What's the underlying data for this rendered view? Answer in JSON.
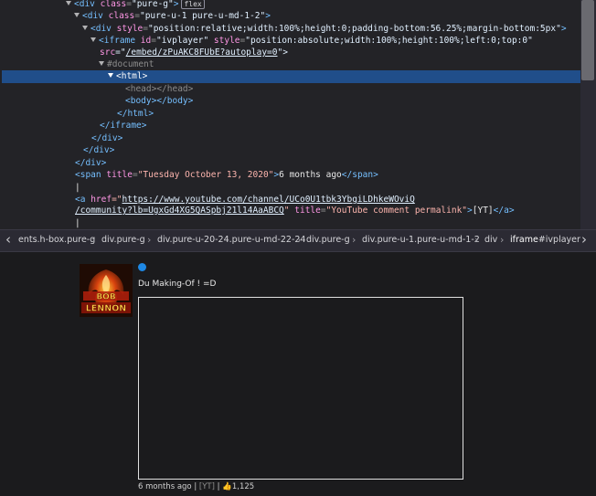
{
  "inspector": {
    "flex_badge": "flex",
    "lines": {
      "l0_open": "<div",
      "l0_attr": "class",
      "l0_val": "\"pure-g\"",
      "l0_close": ">",
      "l1_open": "<div",
      "l1_attr": "class",
      "l1_val": "\"pure-u-1 pure-u-md-1-2\"",
      "l1_close": ">",
      "l2_open": "<div",
      "l2_attr": "style",
      "l2_val": "\"position:relative;width:100%;height:0;padding-bottom:56.25%;margin-bottom:5px\"",
      "l2_close": ">",
      "l3_open": "<iframe",
      "l3_attr1": "id",
      "l3_val1": "\"ivplayer\"",
      "l3_attr2": "style",
      "l3_val2": "\"position:absolute;width:100%;height:100%;left:0;top:0\"",
      "l4_attr": "src",
      "l4_eq": "=\"",
      "l4_url": "/embed/zPuAKC8FUbE?autoplay=0",
      "l4_close": "\">",
      "l5_doc": "#document",
      "l6_html": "<html>",
      "l7_head": "<head></head>",
      "l8_body": "<body></body>",
      "l9_html_close": "</html>",
      "l10_iframe_close": "</iframe>",
      "l11_div_close": "</div>",
      "l12_div_close": "</div>",
      "l13_div_close": "</div>",
      "l14_open": "<span",
      "l14_attr": "title",
      "l14_val": "\"Tuesday October 13, 2020\"",
      "l14_text": "6 months ago",
      "l14_close": "</span>",
      "l15_pipe": "|",
      "l16_open": "<a",
      "l16_attr": "href",
      "l16_eq": "=\"",
      "l16_url": "https://www.youtube.com/channel/UCo0U1tbk3YbgiLDhkeWOviQ",
      "l17_url": "/community?lb=UgxGd4XG5QASpbj21l14AaABCQ",
      "l17_q": "\"",
      "l17_attr": "title",
      "l17_val": "\"YouTube comment permalink\"",
      "l17_text": "[YT]",
      "l17_close": "</a>",
      "l18_pipe": "|"
    }
  },
  "breadcrumb": {
    "items": [
      "ents.h-box.pure-g",
      "div.pure-g",
      "div.pure-u-20-24.pure-u-md-22-24",
      "div.pure-g",
      "div.pure-u-1.pure-u-md-1-2",
      "div",
      "iframe",
      "#ivplayer"
    ]
  },
  "comment": {
    "text": "Du Making-Of ! =D",
    "time": "6 months ago",
    "sep1": " | ",
    "yt": "[YT]",
    "sep2": " | ",
    "likes": "1,125",
    "avatar_text": [
      "BOB",
      "LENNON"
    ]
  },
  "colors": {
    "accent_blue": "#1e88e5",
    "selection": "#204e8a",
    "tag": "#75bfff",
    "attr_name": "#ff97e6"
  },
  "icons": [
    "chevron-left-icon",
    "chevron-right-icon",
    "thumbs-up-icon",
    "expand-triangle-icon"
  ]
}
